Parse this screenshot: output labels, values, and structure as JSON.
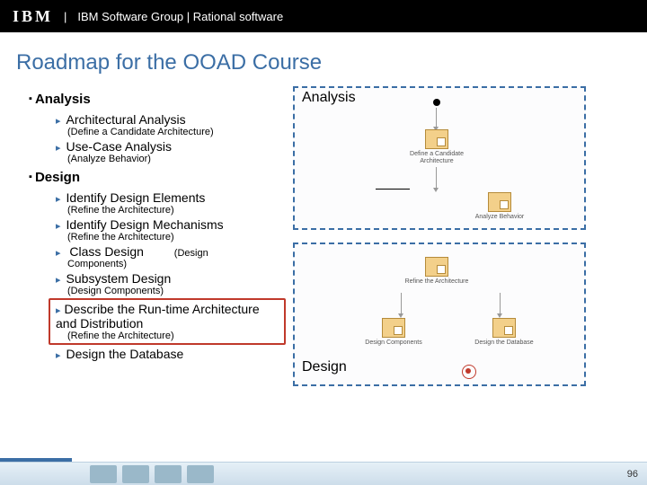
{
  "header": {
    "logo": "IBM",
    "text": "IBM Software Group | Rational software"
  },
  "title": "Roadmap for the OOAD Course",
  "sections": [
    {
      "name": "Analysis",
      "items": [
        {
          "title": "Architectural Analysis",
          "sub": "(Define a Candidate Architecture)"
        },
        {
          "title": "Use-Case Analysis",
          "sub": "(Analyze Behavior)"
        }
      ]
    },
    {
      "name": "Design",
      "items": [
        {
          "title": "Identify Design Elements",
          "sub": "(Refine the Architecture)"
        },
        {
          "title": "Identify Design Mechanisms",
          "sub": "(Refine the Architecture)"
        },
        {
          "title": "Class Design",
          "inline": "(Design",
          "sub": "Components)"
        },
        {
          "title": "Subsystem Design",
          "sub": "(Design Components)"
        },
        {
          "title": "Describe the Run-time Architecture and Distribution",
          "sub": "(Refine the Architecture)",
          "boxed": true
        },
        {
          "title": "Design the Database",
          "sub": ""
        }
      ]
    }
  ],
  "diagram": {
    "analysis_label": "Analysis",
    "design_label": "Design",
    "nodes": {
      "cand": "Define a Candidate Architecture",
      "anbeh": "Analyze Behavior",
      "refine": "Refine the Architecture",
      "dcomp": "Design Components",
      "ddb": "Design the Database"
    }
  },
  "page": "96"
}
